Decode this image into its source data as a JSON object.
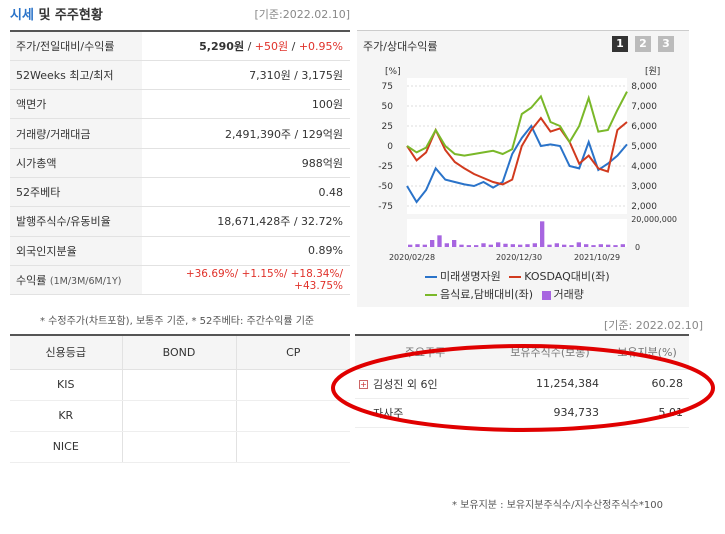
{
  "header": {
    "title_part1": "시세",
    "title_part2": " 및 주주현황",
    "date": "[기준:2022.02.10]"
  },
  "info_rows": [
    {
      "label": "주가/전일대비/수익률"
    },
    {
      "label": "52Weeks 최고/최저",
      "value": "7,310원 / 3,175원"
    },
    {
      "label": "액면가",
      "value": "100원"
    },
    {
      "label": "거래량/거래대금",
      "value": "2,491,390주 / 129억원"
    },
    {
      "label": "시가총액",
      "value": "988억원"
    },
    {
      "label": "52주베타",
      "value": "0.48"
    },
    {
      "label": "발행주식수/유동비율",
      "value": "18,671,428주 / 32.72%"
    },
    {
      "label": "외국인지분율",
      "value": "0.89%"
    },
    {
      "label": "수익률",
      "label_sub": "(1M/3M/6M/1Y)"
    }
  ],
  "price": {
    "price": "5,290원",
    "sep1": " / ",
    "change": "+50원",
    "sep2": " / ",
    "rate": "+0.95%"
  },
  "returns": {
    "v1": "+36.69%",
    "v2": "+1.15%",
    "v3": "+18.34%",
    "v4": "+43.75%",
    "sep": "/ "
  },
  "note1": "* 수정주가(차트포함), 보통주 기준, * 52주베타: 주간수익률 기준",
  "chart_panel": {
    "title": "주가/상대수익률",
    "pages": [
      "1",
      "2",
      "3"
    ]
  },
  "chart_data": {
    "type": "line",
    "left_axis_unit": "[%]",
    "right_axis_unit": "[원]",
    "left_ticks": [
      "75",
      "50",
      "25",
      "0",
      "-25",
      "-50",
      "-75"
    ],
    "right_ticks": [
      "8,000",
      "7,000",
      "6,000",
      "5,000",
      "4,000",
      "3,000",
      "2,000"
    ],
    "volume_tick": "20,000,000",
    "volume_zero": "0",
    "x_labels": [
      "2020/02/28",
      "2020/12/30",
      "2021/10/29"
    ],
    "ylim": [
      -75,
      75
    ],
    "y2lim": [
      2000,
      8000
    ],
    "series": [
      {
        "name": "미래생명자원",
        "color": "#2a73c9",
        "axis": "left",
        "values": [
          -50,
          -70,
          -55,
          -28,
          -42,
          -45,
          -48,
          -50,
          -45,
          -52,
          -45,
          -10,
          10,
          25,
          0,
          2,
          0,
          -25,
          -28,
          5,
          -30,
          -22,
          -12,
          2
        ]
      },
      {
        "name": "KOSDAQ대비(좌)",
        "color": "#d13a1e",
        "axis": "left",
        "values": [
          0,
          -18,
          -8,
          20,
          -5,
          -20,
          -28,
          -35,
          -40,
          -45,
          -48,
          -42,
          0,
          20,
          35,
          18,
          22,
          5,
          -22,
          -12,
          -28,
          -32,
          20,
          30
        ]
      },
      {
        "name": "음식료,담배대비(좌)",
        "color": "#7ab829",
        "axis": "left",
        "values": [
          0,
          -8,
          -2,
          20,
          0,
          -10,
          -12,
          -10,
          -8,
          -6,
          -10,
          -4,
          40,
          48,
          62,
          30,
          25,
          5,
          25,
          60,
          18,
          20,
          45,
          68
        ]
      }
    ],
    "volume": {
      "name": "거래량",
      "color": "#a765e0",
      "values": [
        0.5,
        0.6,
        0.5,
        1.5,
        2.5,
        0.8,
        1.5,
        0.5,
        0.4,
        0.4,
        0.8,
        0.5,
        1.0,
        0.7,
        0.6,
        0.5,
        0.6,
        0.8,
        5.5,
        0.5,
        0.8,
        0.5,
        0.4,
        1.0,
        0.6,
        0.4,
        0.6,
        0.5,
        0.4,
        0.6
      ]
    }
  },
  "credit": {
    "headers": [
      "신용등급",
      "BOND",
      "CP"
    ],
    "rows": [
      [
        "KIS",
        "",
        ""
      ],
      [
        "KR",
        "",
        ""
      ],
      [
        "NICE",
        "",
        ""
      ]
    ]
  },
  "share": {
    "date": "[기준: 2022.02.10]",
    "headers": [
      "주요주주",
      "보유주식수(보통)",
      "보유지분(%)"
    ],
    "rows": [
      {
        "name": "김성진 외 6인",
        "shares": "11,254,384",
        "pct": "60.28",
        "expand": "+"
      },
      {
        "name": "자사주",
        "shares": "934,733",
        "pct": "5.01"
      }
    ],
    "note": "* 보유지분 : 보유지분주식수/지수산정주식수*100"
  },
  "colors": {
    "accent_blue": "#2a73c9",
    "red": "#e0312a",
    "highlight": "#e00000"
  }
}
